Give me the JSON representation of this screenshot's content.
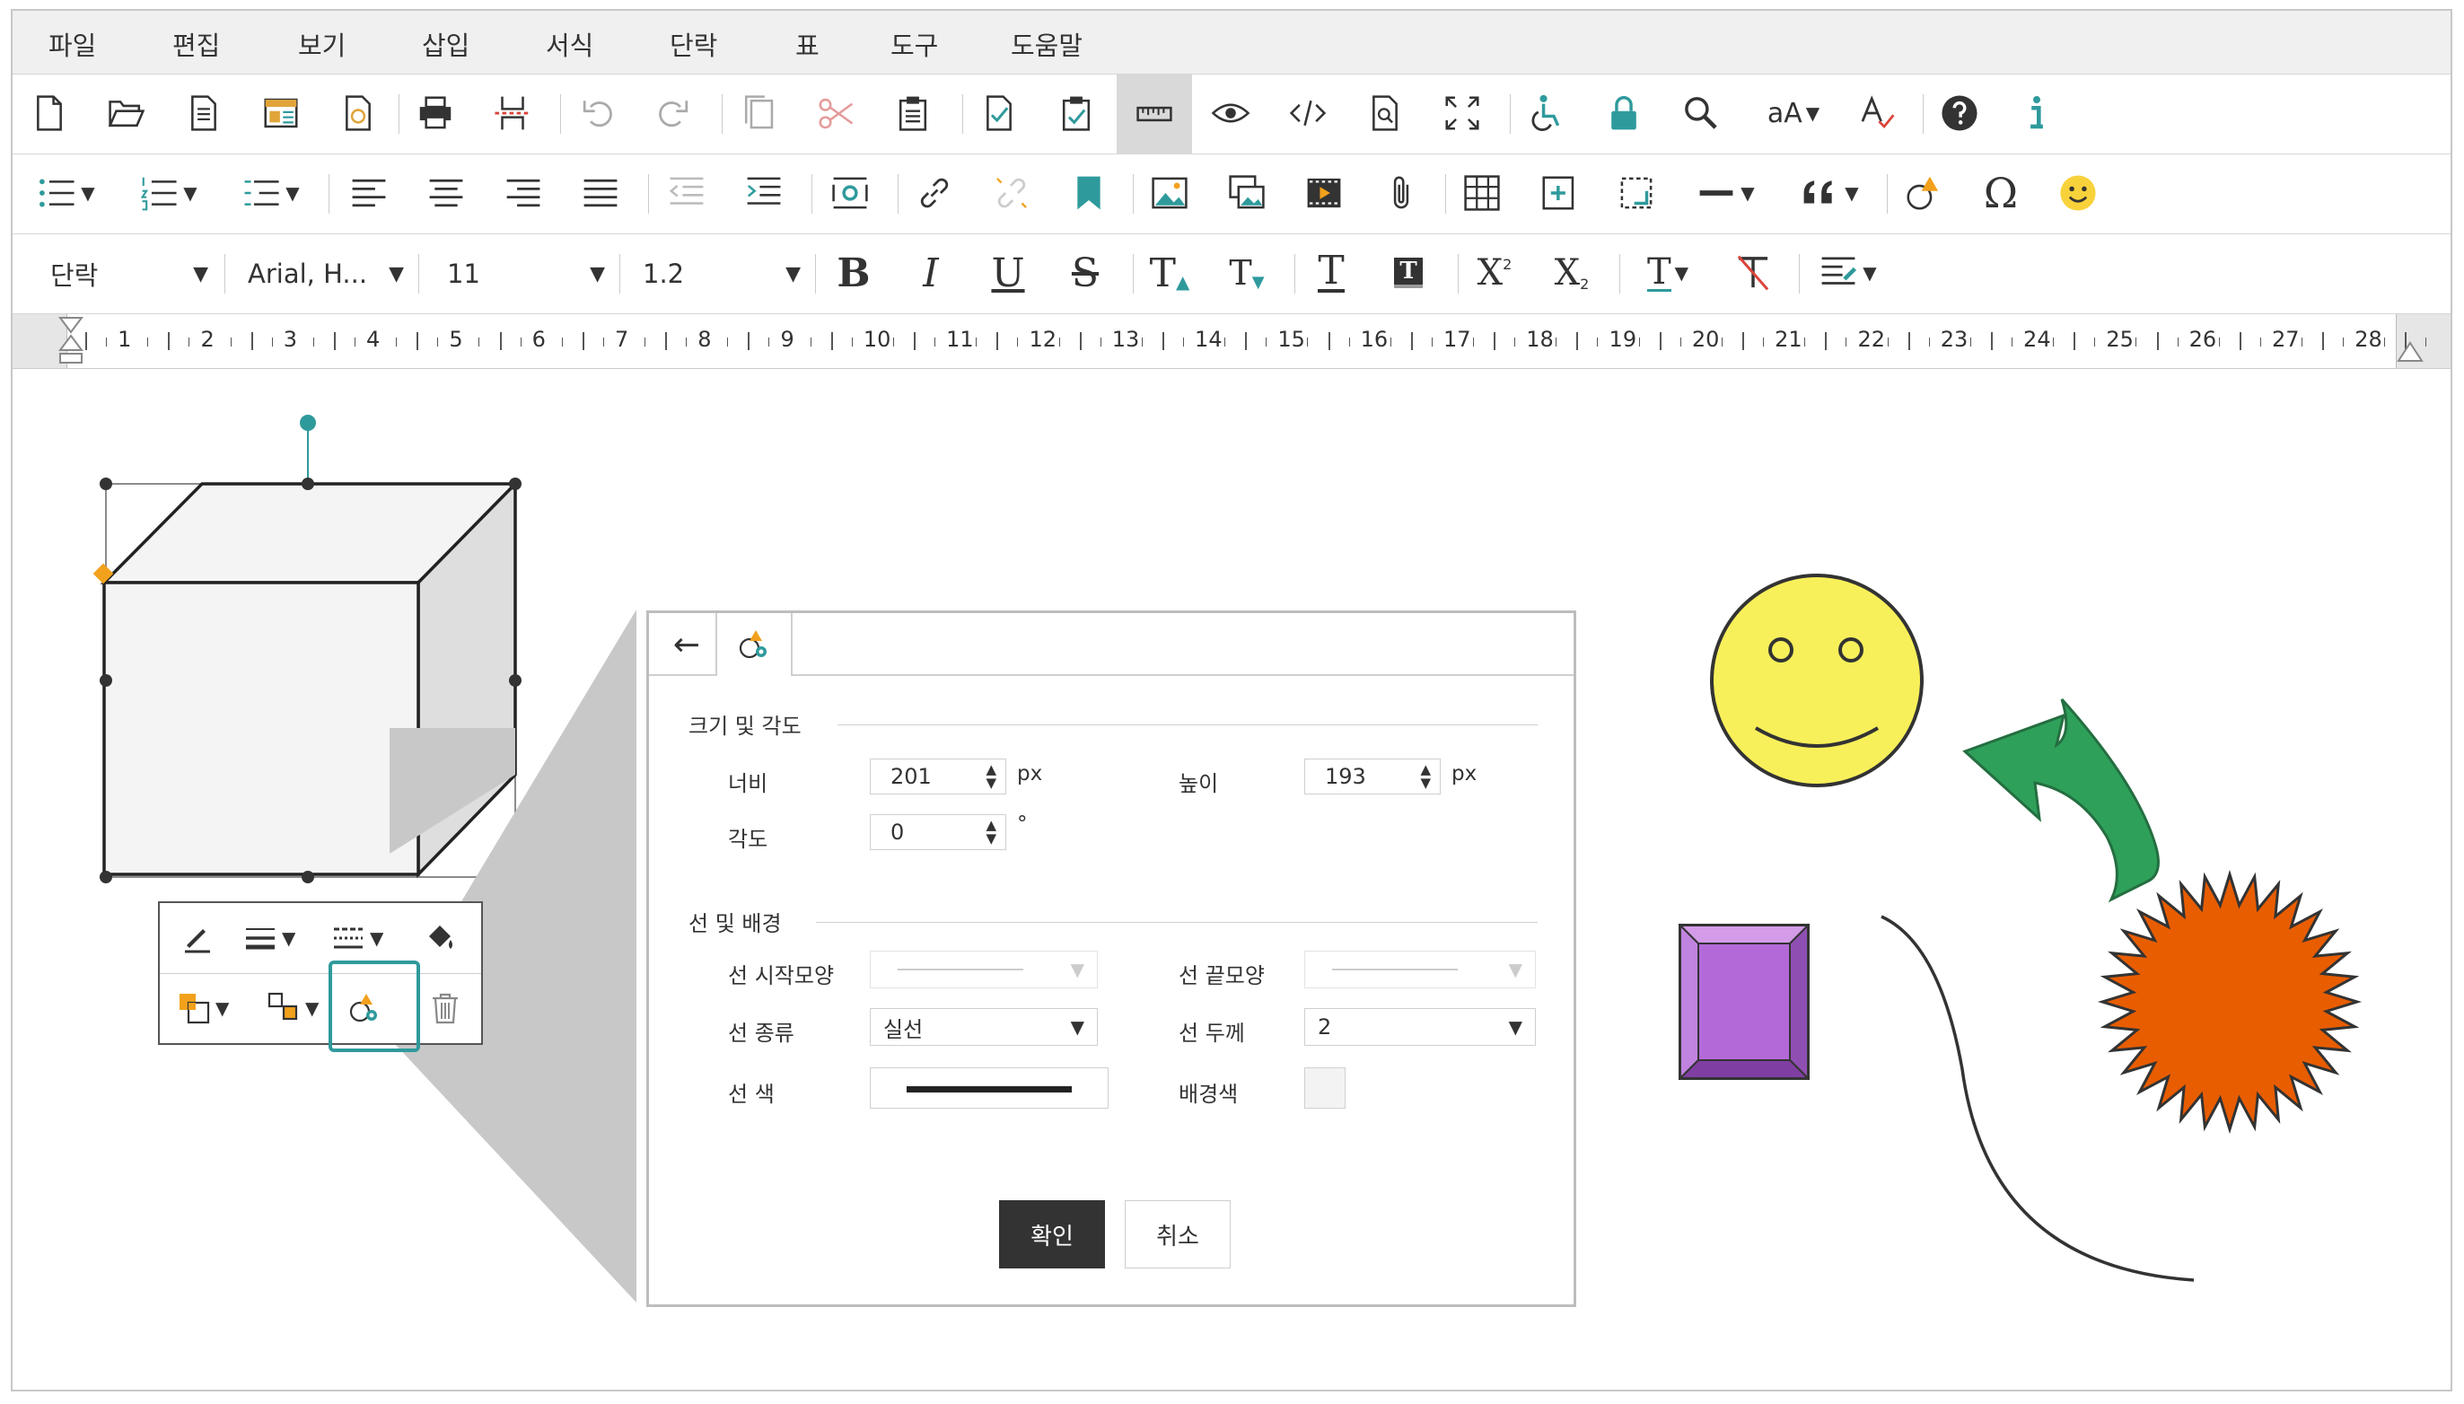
{
  "menu": [
    "파일",
    "편집",
    "보기",
    "삽입",
    "서식",
    "단락",
    "표",
    "도구",
    "도움말"
  ],
  "format_bar": {
    "paragraph_style": "단락",
    "font_family": "Arial, H...",
    "font_size": "11",
    "line_height": "1.2",
    "font_size_case_label": "aA"
  },
  "ruler": {
    "numbers": [
      "1",
      "2",
      "3",
      "4",
      "5",
      "6",
      "7",
      "8",
      "9",
      "10",
      "11",
      "12",
      "13",
      "14",
      "15",
      "16",
      "17",
      "18",
      "19",
      "20",
      "21",
      "22",
      "23",
      "24",
      "25",
      "26",
      "27",
      "28"
    ]
  },
  "dialog": {
    "back_glyph": "←",
    "section_size": "크기 및 각도",
    "width_label": "너비",
    "width_value": "201",
    "height_label": "높이",
    "height_value": "193",
    "unit_px": "px",
    "angle_label": "각도",
    "angle_value": "0",
    "angle_unit": "°",
    "section_line": "선 및 배경",
    "line_start_label": "선 시작모양",
    "line_end_label": "선 끝모양",
    "line_type_label": "선 종류",
    "line_type_value": "실선",
    "line_width_label": "선 두께",
    "line_width_value": "2",
    "line_color_label": "선 색",
    "bg_color_label": "배경색",
    "confirm": "확인",
    "cancel": "취소"
  },
  "colors": {
    "accent_teal": "#2f9a9c",
    "smiley": "#f8f05a",
    "arrow": "#2ea05a",
    "star": "#e85d00",
    "gem": "#b36ad8",
    "handle_orange": "#f2a11c"
  }
}
